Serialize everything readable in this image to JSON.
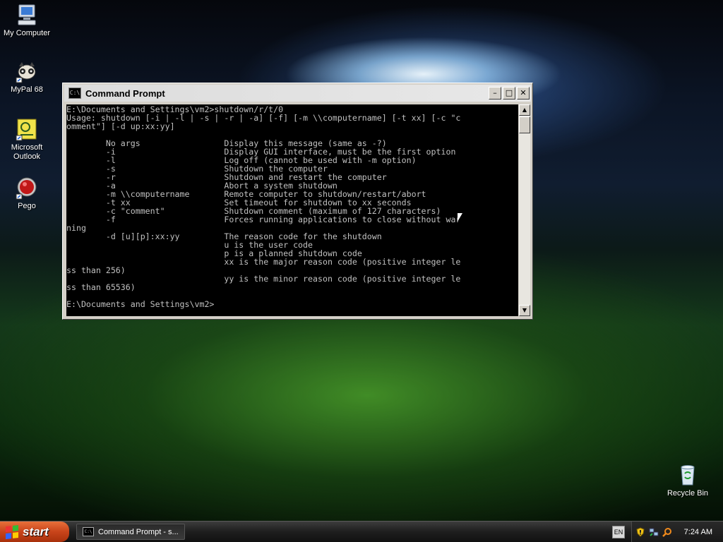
{
  "desktop": {
    "icons": [
      {
        "label": "My Computer"
      },
      {
        "label": "MyPal 68"
      },
      {
        "label": "Microsoft Outlook"
      },
      {
        "label": "Pego"
      },
      {
        "label": "Recycle Bin"
      }
    ]
  },
  "cmd_window": {
    "title": "Command Prompt",
    "icon_text": "C:\\",
    "lines": [
      "E:\\Documents and Settings\\vm2>shutdown/r/t/0",
      "Usage: shutdown [-i | -l | -s | -r | -a] [-f] [-m \\\\computername] [-t xx] [-c \"c",
      "omment\"] [-d up:xx:yy]",
      "",
      "        No args                 Display this message (same as -?)",
      "        -i                      Display GUI interface, must be the first option",
      "        -l                      Log off (cannot be used with -m option)",
      "        -s                      Shutdown the computer",
      "        -r                      Shutdown and restart the computer",
      "        -a                      Abort a system shutdown",
      "        -m \\\\computername       Remote computer to shutdown/restart/abort",
      "        -t xx                   Set timeout for shutdown to xx seconds",
      "        -c \"comment\"            Shutdown comment (maximum of 127 characters)",
      "        -f                      Forces running applications to close without war",
      "ning",
      "        -d [u][p]:xx:yy         The reason code for the shutdown",
      "                                u is the user code",
      "                                p is a planned shutdown code",
      "                                xx is the major reason code (positive integer le",
      "ss than 256)",
      "                                yy is the minor reason code (positive integer le",
      "ss than 65536)",
      "",
      "E:\\Documents and Settings\\vm2>"
    ]
  },
  "taskbar": {
    "start_label": "start",
    "tasks": [
      {
        "label": "Command Prompt - s..."
      }
    ],
    "language": "EN",
    "clock": "7:24 AM"
  }
}
